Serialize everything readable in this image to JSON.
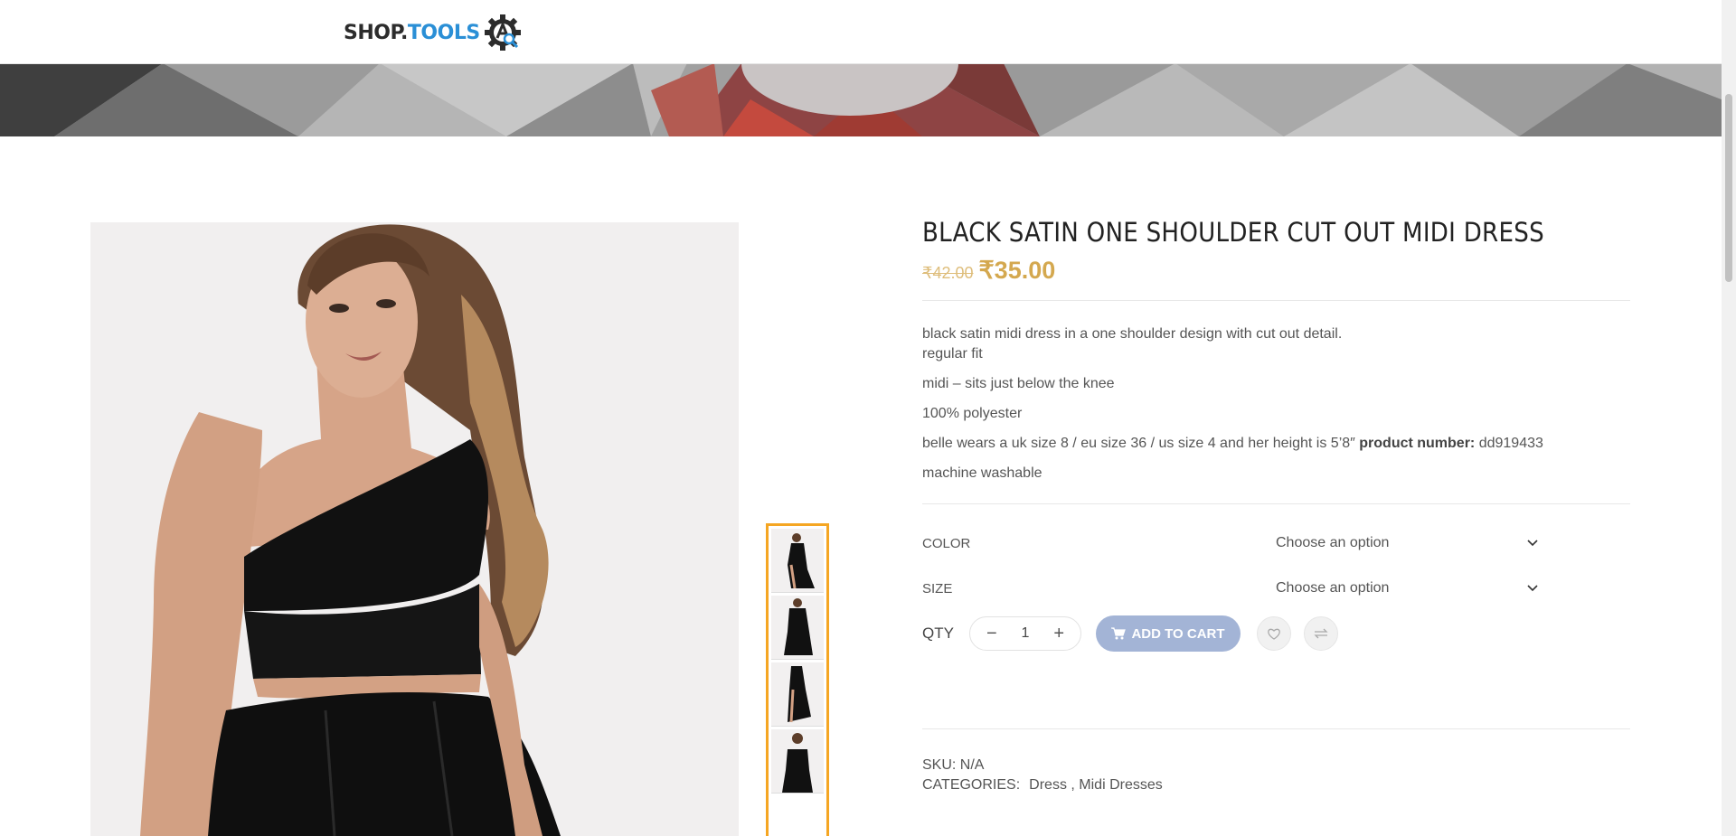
{
  "header": {
    "logo_shop": "SHOP.",
    "logo_tools": "TOOLS"
  },
  "product": {
    "title": "BLACK SATIN ONE SHOULDER CUT OUT MIDI DRESS",
    "old_price": "₹42.00",
    "new_price": "₹35.00",
    "description": {
      "line1": "black satin midi dress in a one shoulder design with cut out detail.",
      "line2": "regular fit",
      "line3": "midi – sits just below the knee",
      "line4": "100% polyester",
      "line5_text": "belle wears a uk size 8 / eu size 36 / us size 4 and her height is 5’8″ ",
      "line5_bold": "product number:",
      "line5_value": " dd919433",
      "line6": "machine washable"
    },
    "variations": [
      {
        "label": "COLOR",
        "placeholder": "Choose an option"
      },
      {
        "label": "SIZE",
        "placeholder": "Choose an option"
      }
    ],
    "qty_label": "QTY",
    "qty_value": "1",
    "qty_minus": "−",
    "qty_plus": "+",
    "add_to_cart": "ADD TO CART",
    "sku_label": "SKU:",
    "sku_value": "N/A",
    "categories_label": "CATEGORIES:",
    "categories_value": "Dress , Midi Dresses"
  },
  "colors": {
    "price": "#d4a84f",
    "cart_button": "#a3b4d6",
    "thumb_border": "#f5a623",
    "logo_blue": "#2a8fd6"
  },
  "icons": {
    "chevron": "chevron-down-icon",
    "cart": "cart-icon",
    "wishlist": "heart-icon",
    "compare": "compare-arrows-icon",
    "logo": "gear-search-icon"
  }
}
